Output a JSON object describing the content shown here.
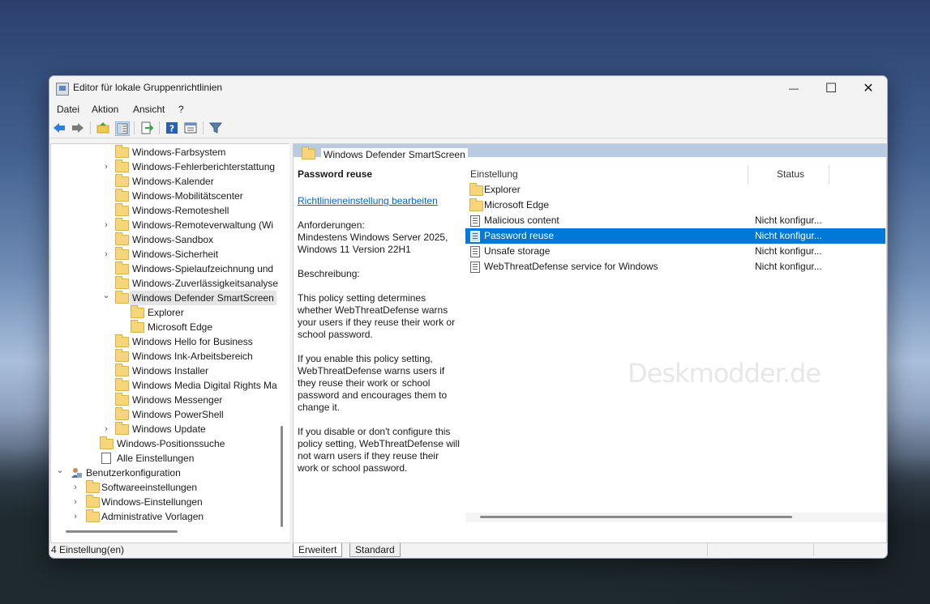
{
  "window": {
    "title": "Editor für lokale Gruppenrichtlinien",
    "controls": {
      "minimize": "—",
      "maximize": "☐",
      "close": "✕"
    }
  },
  "menu": {
    "file": "Datei",
    "action": "Aktion",
    "view": "Ansicht",
    "help": "?"
  },
  "toolbar": {
    "buttons": [
      "back-icon",
      "forward-icon",
      "up-folder-icon",
      "show-hide-tree-icon",
      "export-list-icon",
      "help-icon",
      "properties-icon",
      "filter-icon"
    ]
  },
  "tree": {
    "items": [
      {
        "label": "Windows-Farbsystem",
        "expandable": false
      },
      {
        "label": "Windows-Fehlerberichterstattung",
        "expandable": true
      },
      {
        "label": "Windows-Kalender",
        "expandable": false
      },
      {
        "label": "Windows-Mobilitätscenter",
        "expandable": false
      },
      {
        "label": "Windows-Remoteshell",
        "expandable": false
      },
      {
        "label": "Windows-Remoteverwaltung (Wi",
        "expandable": true
      },
      {
        "label": "Windows-Sandbox",
        "expandable": false
      },
      {
        "label": "Windows-Sicherheit",
        "expandable": true
      },
      {
        "label": "Windows-Spielaufzeichnung und",
        "expandable": false
      },
      {
        "label": "Windows-Zuverlässigkeitsanalyse",
        "expandable": false
      },
      {
        "label": "Windows Defender SmartScreen",
        "expandable": true,
        "expanded": true,
        "selected": true
      },
      {
        "label": "Explorer",
        "child": true
      },
      {
        "label": "Microsoft Edge",
        "child": true
      },
      {
        "label": "Windows Hello for Business",
        "expandable": false
      },
      {
        "label": "Windows Ink-Arbeitsbereich",
        "expandable": false
      },
      {
        "label": "Windows Installer",
        "expandable": false
      },
      {
        "label": "Windows Media Digital Rights Ma",
        "expandable": false
      },
      {
        "label": "Windows Messenger",
        "expandable": false
      },
      {
        "label": "Windows PowerShell",
        "expandable": false
      },
      {
        "label": "Windows Update",
        "expandable": true
      },
      {
        "label": "Windows-Positionssuche",
        "level_up": true
      },
      {
        "label": "Alle Einstellungen",
        "level_up": true,
        "icon": "settings-list-icon"
      },
      {
        "label": "Benutzerkonfiguration",
        "root": true,
        "icon": "user-config-icon"
      },
      {
        "label": "Softwareeinstellungen",
        "root_child": true
      },
      {
        "label": "Windows-Einstellungen",
        "root_child": true
      },
      {
        "label": "Administrative Vorlagen",
        "root_child": true
      }
    ]
  },
  "details": {
    "header": "Windows Defender SmartScreen",
    "policy_title": "Password reuse",
    "edit_link": "Richtlinieneinstellung bearbeiten",
    "requirements_label": "Anforderungen:",
    "requirements_text": "Mindestens Windows Server 2025, Windows 11 Version 22H1",
    "description_label": "Beschreibung:",
    "paragraph1": "This policy setting determines whether WebThreatDefense warns your users if they reuse their work or school password.",
    "paragraph2": "If you enable this policy setting, WebThreatDefense warns users if they reuse their work or school password and encourages them to change it.",
    "paragraph3": "If you disable or don't configure this policy setting, WebThreatDefense will not warn users if they reuse their work or school password."
  },
  "list": {
    "col_setting": "Einstellung",
    "col_status": "Status",
    "rows": [
      {
        "name": "Explorer",
        "status": "",
        "type": "folder"
      },
      {
        "name": "Microsoft Edge",
        "status": "",
        "type": "folder"
      },
      {
        "name": "Malicious content",
        "status": "Nicht konfigur...",
        "type": "policy"
      },
      {
        "name": "Password reuse",
        "status": "Nicht konfigur...",
        "type": "policy",
        "selected": true
      },
      {
        "name": "Unsafe storage",
        "status": "Nicht konfigur...",
        "type": "policy"
      },
      {
        "name": "WebThreatDefense service for Windows",
        "status": "Nicht konfigur...",
        "type": "policy"
      }
    ]
  },
  "tabs": {
    "extended": "Erweitert",
    "standard": "Standard"
  },
  "statusbar": {
    "text": "4 Einstellung(en)"
  },
  "watermark": "Deskmodder.de",
  "colors": {
    "selection": "#0078d7",
    "link": "#0066cc",
    "folder": "#f7d57a",
    "header_bar": "#b9cbe0"
  }
}
